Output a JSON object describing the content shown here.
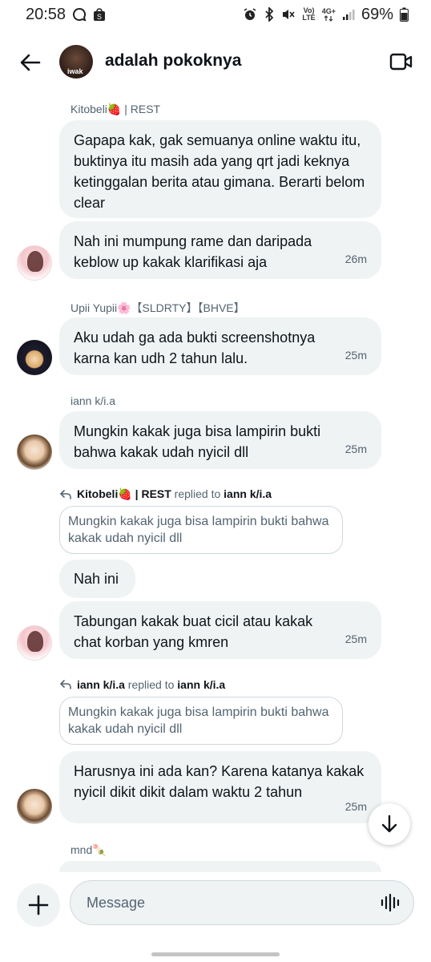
{
  "status_bar": {
    "time": "20:58",
    "battery": "69%",
    "volte_label": "Vo)\nLTE",
    "network_label": "4G+"
  },
  "header": {
    "title": "adalah pokoknya",
    "avatar_tag": "iwak"
  },
  "messages": {
    "m1_sender": "Kitobeli🍓 | REST",
    "m1_text": "Gapapa kak, gak semuanya online waktu itu, buktinya itu masih ada yang qrt jadi keknya ketinggalan berita atau gimana. Berarti belom clear",
    "m2_text": "Nah ini mumpung rame dan daripada keblow up kakak klarifikasi aja",
    "m2_time": "26m",
    "m3_sender": "Upii Yupii🌸【SLDRTY】【BHVE】",
    "m3_text": "Aku udah ga ada bukti screenshotnya karna kan udh 2 tahun lalu.",
    "m3_time": "25m",
    "m4_sender": "iann k/i.a",
    "m4_text": "Mungkin kakak juga bisa lampirin bukti bahwa kakak udah nyicil dll",
    "m4_time": "25m",
    "reply1_from": "Kitobeli🍓 | REST",
    "reply1_mid": " replied to ",
    "reply1_to": "iann k/i.a",
    "reply1_quote": "Mungkin kakak juga bisa lampirin bukti bahwa kakak udah nyicil dll",
    "m5_text": "Nah ini",
    "m6_text": "Tabungan kakak buat cicil atau kakak chat korban yang kmren",
    "m6_time": "25m",
    "reply2_from": "iann k/i.a",
    "reply2_mid": " replied to ",
    "reply2_to": "iann k/i.a",
    "reply2_quote": "Mungkin kakak juga bisa lampirin bukti bahwa kakak udah nyicil dll",
    "m7_text": "Harusnya ini ada kan? Karena katanya kakak nyicil dikit dikit dalam waktu 2 tahun",
    "m7_time": "25m",
    "m8_sender": "mnd🍡"
  },
  "composer": {
    "placeholder": "Message"
  },
  "icons": {
    "back": "arrow-left-icon",
    "video": "video-camera-icon",
    "add": "plus-icon",
    "voice": "waveform-icon",
    "scroll": "arrow-down-icon"
  }
}
